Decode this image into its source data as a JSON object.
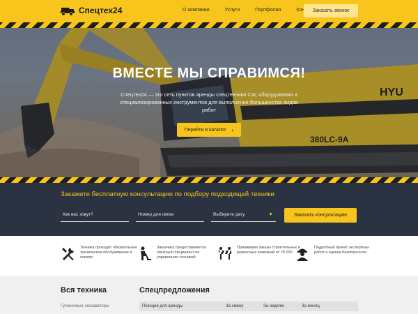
{
  "header": {
    "logo_text": "Спецтех24",
    "logo_icon": "dump-truck-icon",
    "nav": [
      "О компании",
      "Услуги",
      "Портфолио",
      "Контакты"
    ],
    "cta_label": "Заказать звонок",
    "brand_color": "#f7c51c"
  },
  "hero": {
    "title": "ВМЕСТЕ МЫ СПРАВИМСЯ!",
    "text": "Спецтех24 — это сеть пунктов аренды спецтехники Cat, оборудования и специализированных инструментов для выполнения большинства видов работ",
    "button_label": "Перейти в каталог",
    "button_icon": "chevron-right-icon",
    "machine_label": "380LC-9A",
    "brand_on_machine": "HYU"
  },
  "consult": {
    "title": "Закажите бесплатную консультацию по подбору подходящей техники",
    "name_placeholder": "Как вас зовут?",
    "phone_placeholder": "Номер для связи",
    "date_placeholder": "Выберите дату",
    "button_label": "Заказать консультацию"
  },
  "features": [
    {
      "icon": "tools-icon",
      "text": "Техника проходит обязательное техническое обслуживание и осмотр"
    },
    {
      "icon": "worker-icon",
      "text": "Заказчику предоставляется опытный специалист по управлению техникой"
    },
    {
      "icon": "barrier-icon",
      "text": "Принимаем заказы строительных и ремонтных компаний от 20 000"
    },
    {
      "icon": "engineer-icon",
      "text": "Подробный проект экспертизы работ и оценки безопасности"
    }
  ],
  "bottom": {
    "all_title": "Вся техника",
    "all_link": "Гусеничные экскаваторы",
    "spec_title": "Спецпредложения",
    "table_headers": [
      "Позиция для аренды",
      "За смену",
      "За неделю",
      "За месяц"
    ]
  }
}
